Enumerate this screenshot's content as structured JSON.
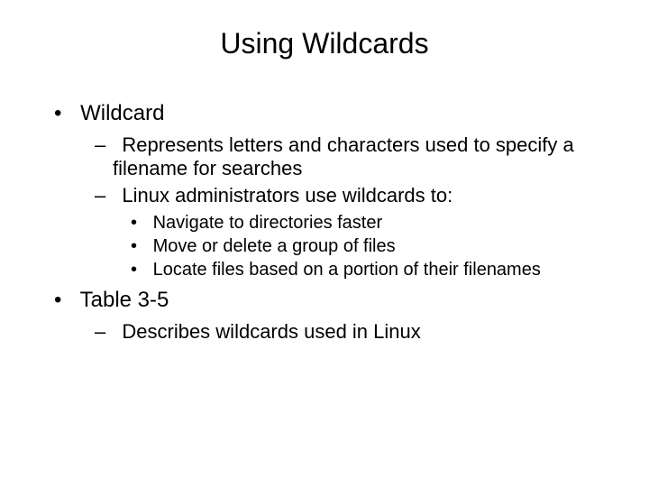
{
  "title": "Using Wildcards",
  "bullets": {
    "b1": "Wildcard",
    "b1_1": "Represents letters and characters used to specify a filename for searches",
    "b1_2": "Linux administrators use wildcards to:",
    "b1_2_1": "Navigate to directories faster",
    "b1_2_2": "Move or delete a group of files",
    "b1_2_3": "Locate files based on a portion of their filenames",
    "b2": "Table 3-5",
    "b2_1": "Describes wildcards used in Linux"
  }
}
